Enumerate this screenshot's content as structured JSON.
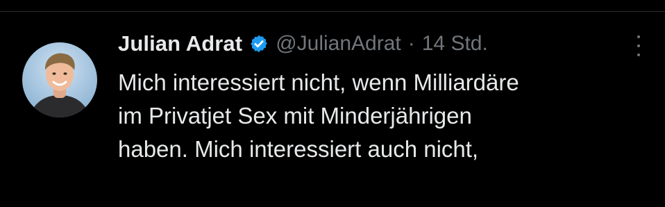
{
  "tweet": {
    "author": {
      "display_name": "Julian Adrat",
      "handle": "@JulianAdrat",
      "verified": true,
      "verified_color": "#1d9bf0"
    },
    "separator": "·",
    "time": "14 Std.",
    "text_lines": [
      "Mich interessiert nicht, wenn Milliardäre",
      "im Privatjet Sex mit Minderjährigen",
      "haben. Mich interessiert auch nicht,"
    ],
    "icons": {
      "avatar": "profile-photo",
      "verified": "verified-badge-icon",
      "more": "more-options-icon"
    }
  },
  "theme": {
    "background": "#000000",
    "primary_text": "#e7e9ea",
    "secondary_text": "#71767b"
  }
}
